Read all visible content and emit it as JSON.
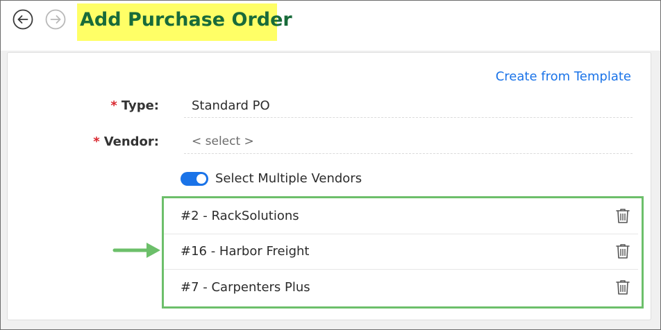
{
  "header": {
    "title": "Add Purchase Order",
    "back_icon": "arrow-left-circle-icon",
    "forward_icon": "arrow-right-circle-icon"
  },
  "form": {
    "create_template_link": "Create from Template",
    "required_marker": "*",
    "type": {
      "label": "Type:",
      "value": "Standard PO"
    },
    "vendor": {
      "label": "Vendor:",
      "placeholder": "< select >"
    },
    "multi_vendor_toggle": {
      "label": "Select Multiple Vendors",
      "enabled": true
    },
    "vendors": [
      {
        "name": "#2 - RackSolutions",
        "action_icon": "trash-icon"
      },
      {
        "name": "#16 - Harbor Freight",
        "action_icon": "trash-icon"
      },
      {
        "name": "#7 - Carpenters Plus",
        "action_icon": "trash-icon"
      }
    ]
  },
  "annotations": {
    "highlight_color": "#ffff66",
    "box_color": "#6cbf6a",
    "arrow_icon": "green-arrow-right-icon"
  },
  "colors": {
    "title": "#186b3a",
    "accent": "#1a73e8",
    "required": "#d9262e"
  }
}
